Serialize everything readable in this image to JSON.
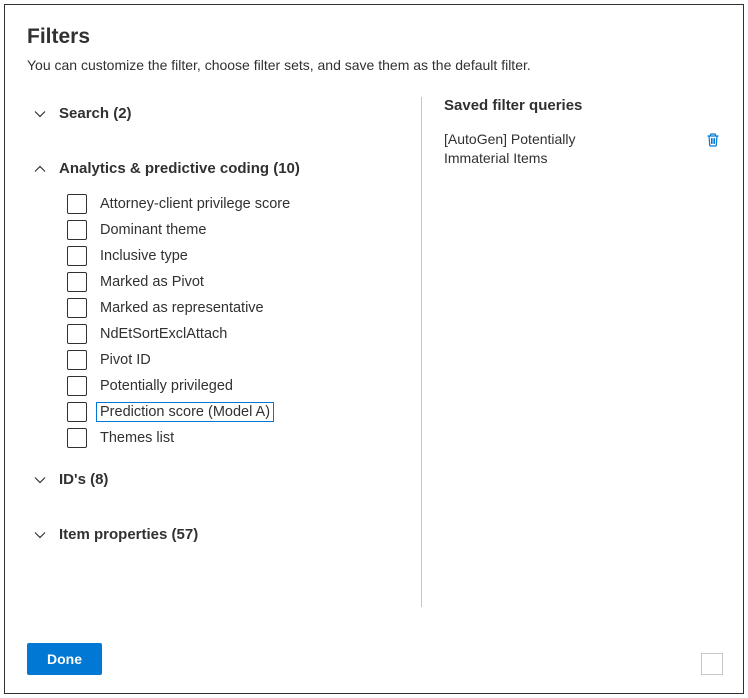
{
  "header": {
    "title": "Filters",
    "subtitle": "You can customize the filter, choose filter sets, and save them as the default filter."
  },
  "sections": {
    "search": {
      "label": "Search (2)",
      "expanded": false
    },
    "analytics": {
      "label": "Analytics & predictive coding (10)",
      "expanded": true,
      "items": [
        {
          "label": "Attorney-client privilege score",
          "highlighted": false
        },
        {
          "label": "Dominant theme",
          "highlighted": false
        },
        {
          "label": "Inclusive type",
          "highlighted": false
        },
        {
          "label": "Marked as Pivot",
          "highlighted": false
        },
        {
          "label": "Marked as representative",
          "highlighted": false
        },
        {
          "label": "NdEtSortExclAttach",
          "highlighted": false
        },
        {
          "label": "Pivot ID",
          "highlighted": false
        },
        {
          "label": "Potentially privileged",
          "highlighted": false
        },
        {
          "label": "Prediction score (Model A)",
          "highlighted": true
        },
        {
          "label": "Themes list",
          "highlighted": false
        }
      ]
    },
    "ids": {
      "label": "ID's (8)",
      "expanded": false
    },
    "item_props": {
      "label": "Item properties (57)",
      "expanded": false
    }
  },
  "saved": {
    "title": "Saved filter queries",
    "items": [
      {
        "label": "[AutoGen] Potentially Immaterial Items"
      }
    ]
  },
  "footer": {
    "done_label": "Done"
  }
}
